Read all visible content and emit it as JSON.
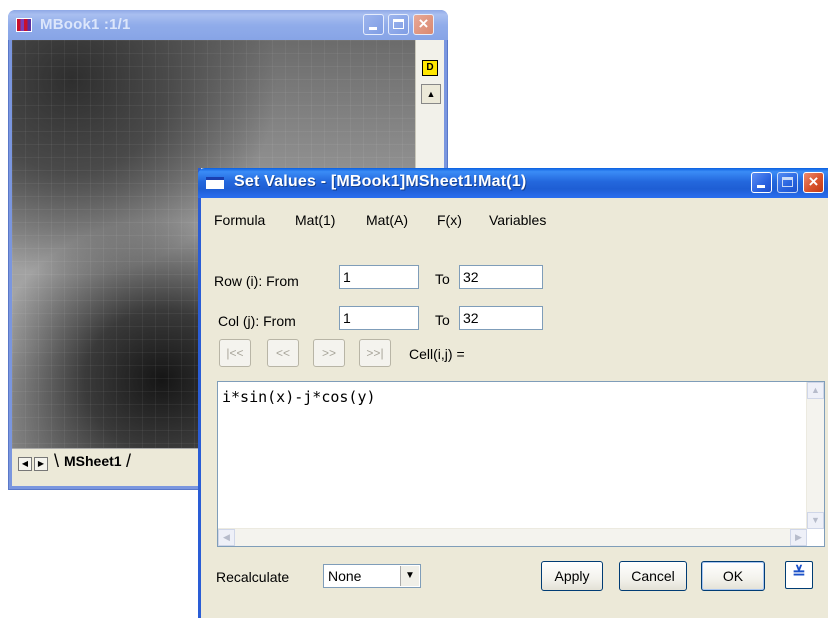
{
  "mbook": {
    "title": "MBook1 :1/1",
    "badge": "D",
    "sheet_tab": "MSheet1"
  },
  "dialog": {
    "title": "Set Values - [MBook1]MSheet1!Mat(1)",
    "menu": [
      "Formula",
      "Mat(1)",
      "Mat(A)",
      "F(x)",
      "Variables"
    ],
    "row": {
      "label": "Row (i): From",
      "from": "1",
      "to_label": "To",
      "to": "32"
    },
    "col": {
      "label": "Col (j): From",
      "from": "1",
      "to_label": "To",
      "to": "32"
    },
    "nav_buttons": [
      "|<<",
      "<<",
      ">>",
      ">>|"
    ],
    "cell_label": "Cell(i,j) =",
    "formula": "i*sin(x)-j*cos(y)",
    "recalculate_label": "Recalculate",
    "recalculate_value": "None",
    "buttons": {
      "apply": "Apply",
      "cancel": "Cancel",
      "ok": "OK"
    },
    "expand_glyph": "≚"
  },
  "colors": {
    "title_active": "#2468dd",
    "title_inactive": "#90acea",
    "close_button": "#d9532c",
    "dialog_face": "#ece9d8",
    "badge_yellow": "#ffe600"
  }
}
